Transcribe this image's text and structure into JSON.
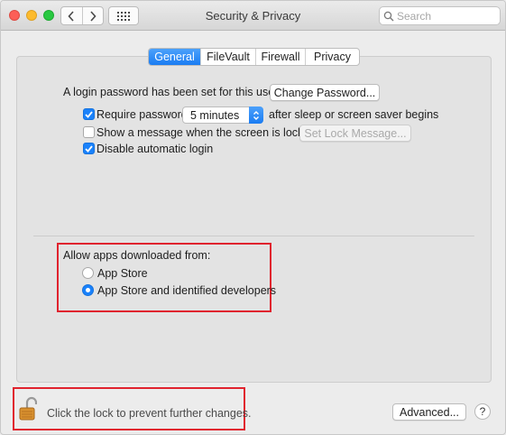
{
  "window": {
    "title": "Security & Privacy"
  },
  "search": {
    "placeholder": "Search"
  },
  "tabs": [
    {
      "label": "General",
      "active": true
    },
    {
      "label": "FileVault",
      "active": false
    },
    {
      "label": "Firewall",
      "active": false
    },
    {
      "label": "Privacy",
      "active": false
    }
  ],
  "general": {
    "login_password_text": "A login password has been set for this user",
    "change_password_button": "Change Password...",
    "require_password": {
      "label": "Require password",
      "checked": true
    },
    "require_password_delay": "5 minutes",
    "require_password_suffix": "after sleep or screen saver begins",
    "show_message": {
      "label": "Show a message when the screen is locked",
      "checked": false
    },
    "set_lock_message_button": "Set Lock Message...",
    "disable_auto_login": {
      "label": "Disable automatic login",
      "checked": true
    }
  },
  "allow_apps": {
    "heading": "Allow apps downloaded from:",
    "options": [
      {
        "label": "App Store",
        "selected": false
      },
      {
        "label": "App Store and identified developers",
        "selected": true
      }
    ]
  },
  "footer": {
    "lock_text": "Click the lock to prevent further changes.",
    "advanced_button": "Advanced...",
    "help_label": "?"
  },
  "colors": {
    "accent": "#1a82fb",
    "highlight_box": "#e0232e"
  }
}
